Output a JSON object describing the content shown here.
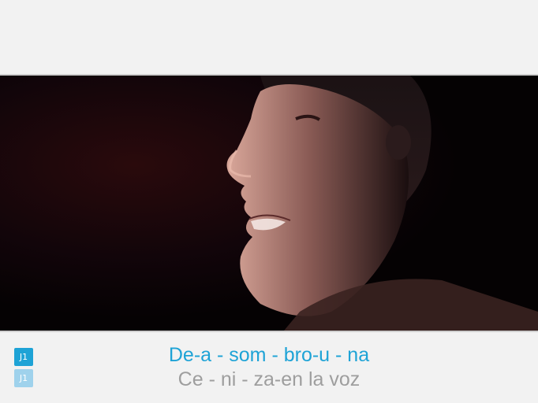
{
  "players": {
    "p1_label": "J1",
    "p2_label": "J1"
  },
  "lyrics": {
    "current_line": "De-a - som - bro-u - na",
    "next_line": "Ce - ni - za-en la voz"
  },
  "colors": {
    "highlight": "#1ea3d6",
    "upcoming": "#9e9e9e",
    "badge_inactive": "#9fd2ec",
    "background": "#f2f2f2"
  }
}
